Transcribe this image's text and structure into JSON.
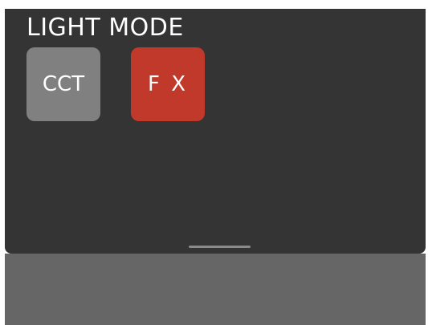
{
  "panel": {
    "title": "LIGHT MODE",
    "buttons": [
      {
        "id": "cct",
        "label": "CCT",
        "color": "#808080",
        "selected": false
      },
      {
        "id": "fx",
        "label": "F X",
        "color": "#c0392b",
        "selected": true
      }
    ]
  },
  "colors": {
    "panel_background": "#333433",
    "bottom_area": "#666666",
    "handle": "#8a8a8a"
  },
  "handle_icon": "drag-handle"
}
